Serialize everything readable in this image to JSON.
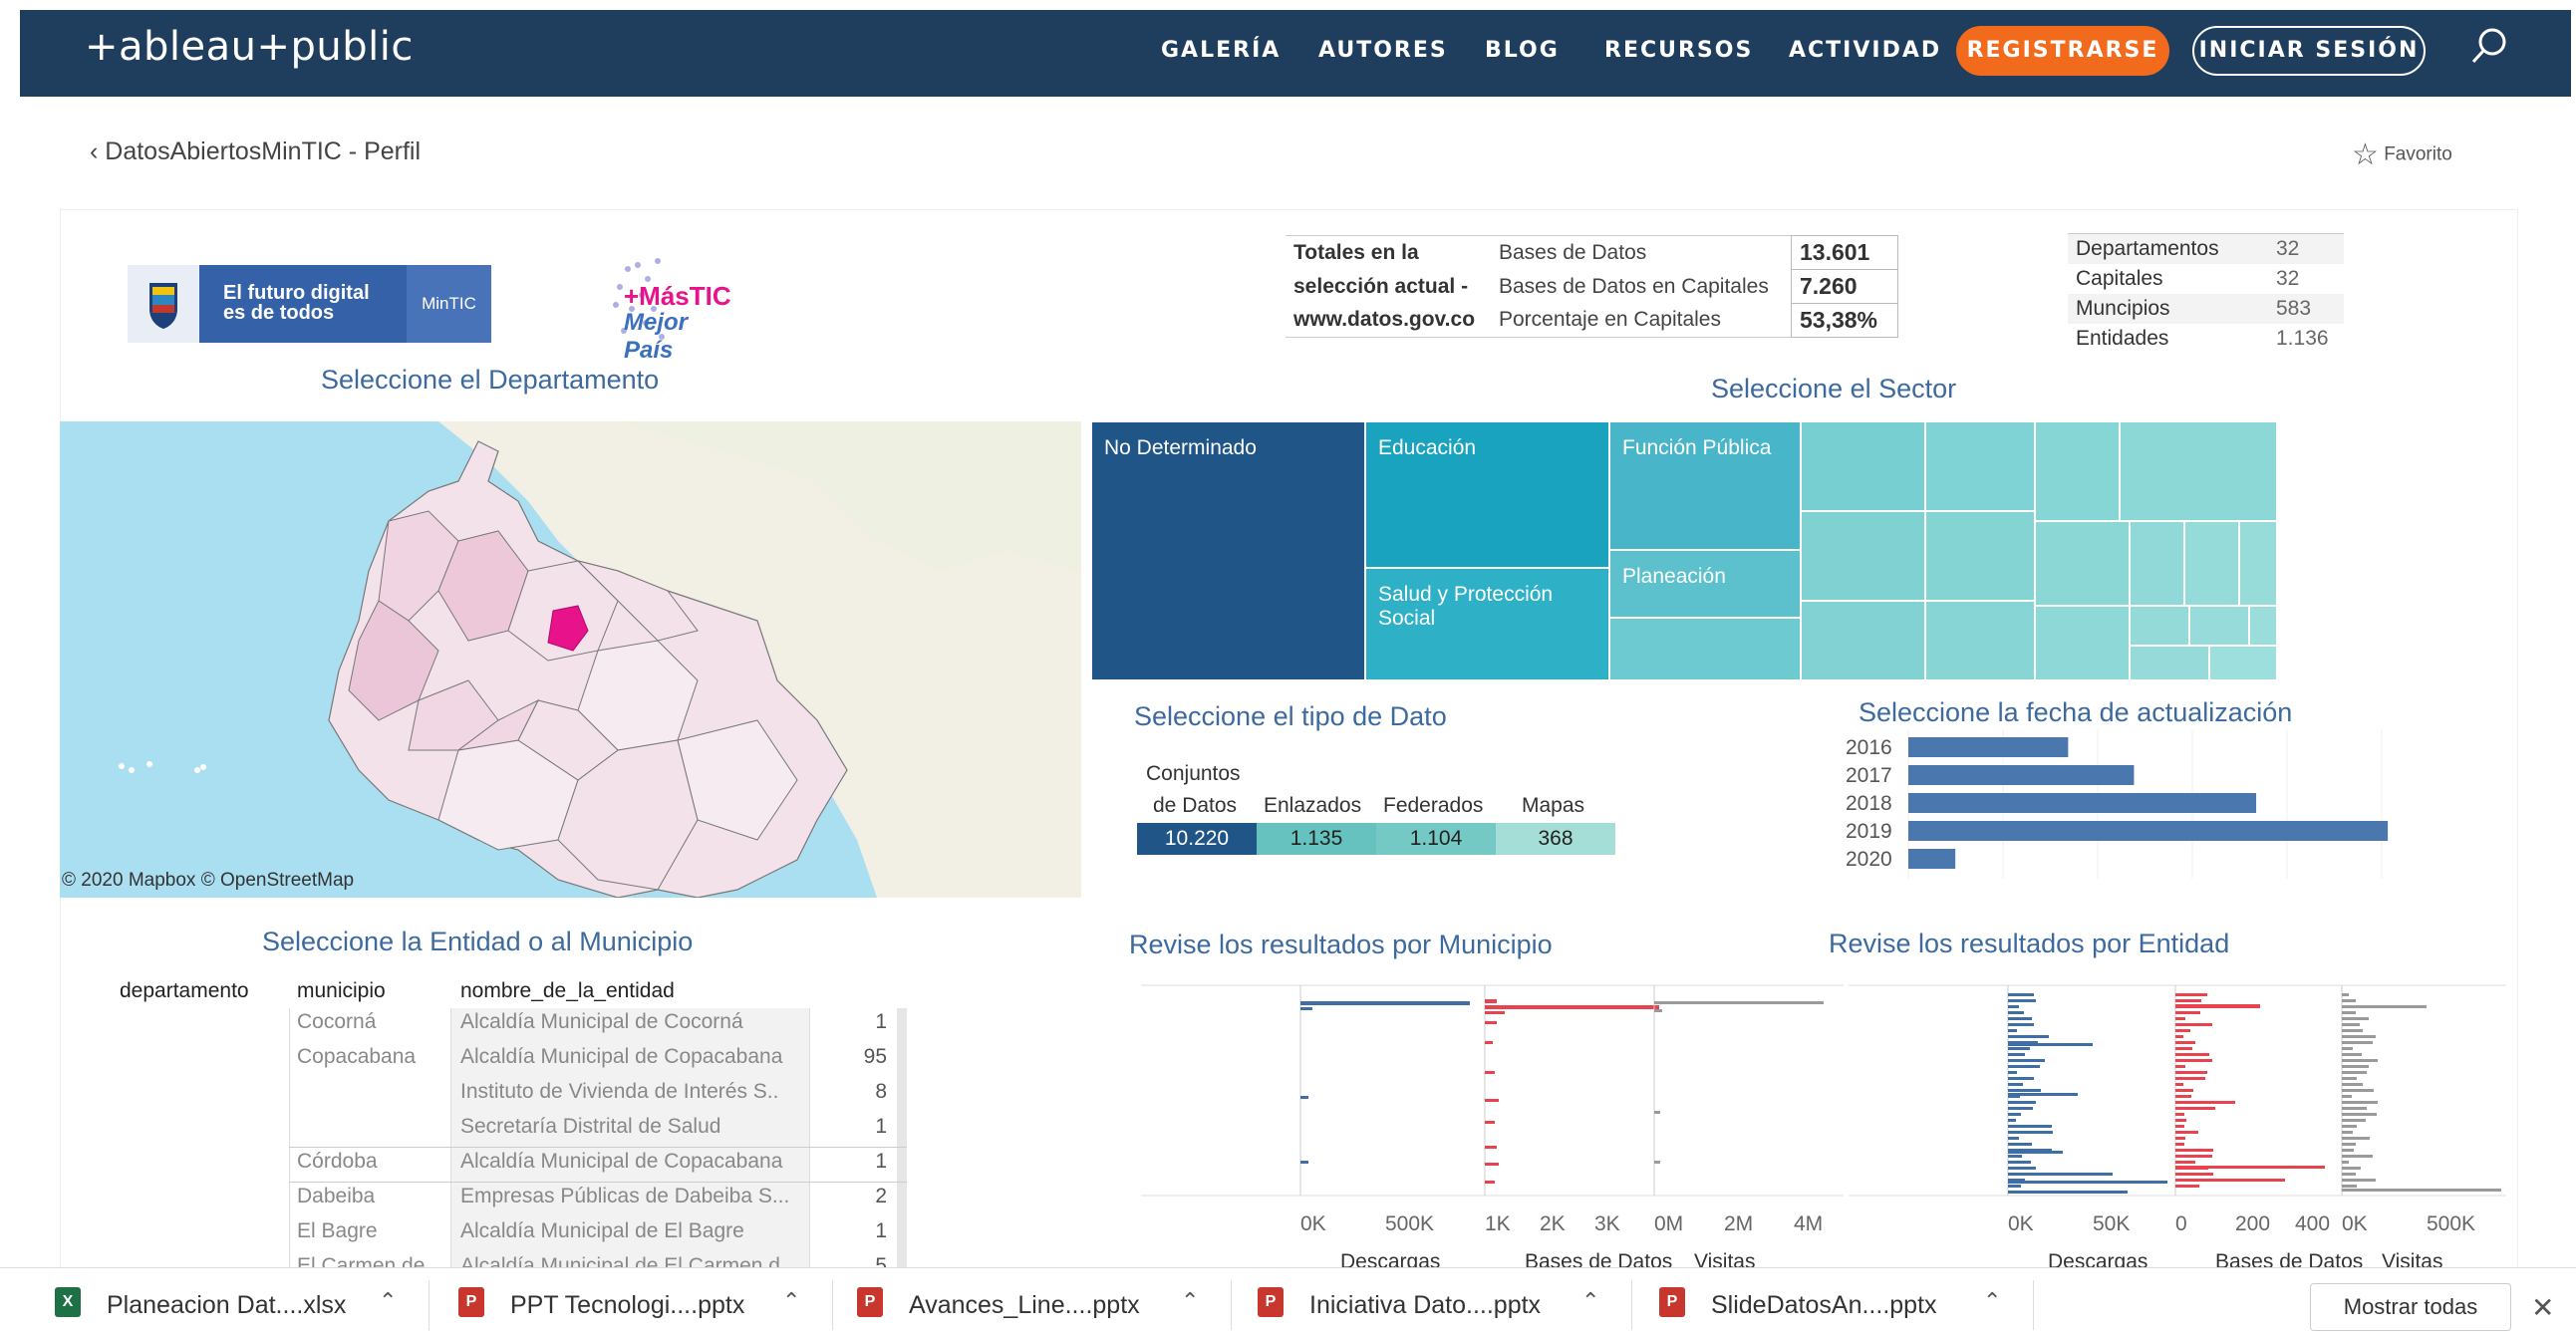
{
  "nav": {
    "logo": "+ableau+public",
    "links": [
      "GALERÍA",
      "AUTORES",
      "BLOG",
      "RECURSOS",
      "ACTIVIDAD"
    ],
    "register": "REGISTRARSE",
    "login": "INICIAR SESIÓN"
  },
  "breadcrumb": "DatosAbiertosMinTIC - Perfil",
  "favorite": "Favorito",
  "banner": {
    "line1": "El futuro digital",
    "line2": "es de todos",
    "mintic": "MinTIC",
    "mastic1": "+MásTIC",
    "mastic2": "Mejor País"
  },
  "totals": {
    "label1": "Totales en la",
    "label2": "selección actual -",
    "label3": "www.datos.gov.co",
    "rows": [
      {
        "name": "Bases de Datos",
        "value": "13.601"
      },
      {
        "name": "Bases de Datos en Capitales",
        "value": "7.260"
      },
      {
        "name": "Porcentaje en Capitales",
        "value": "53,38%"
      }
    ]
  },
  "counts": [
    {
      "name": "Departamentos",
      "value": "32"
    },
    {
      "name": "Capitales",
      "value": "32"
    },
    {
      "name": "Muncipios",
      "value": "583"
    },
    {
      "name": "Entidades",
      "value": "1.136"
    }
  ],
  "titles": {
    "departamento": "Seleccione el Departamento",
    "sector": "Seleccione el Sector",
    "tipo": "Seleccione el tipo de Dato",
    "fecha": "Seleccione la fecha de actualización",
    "entidad": "Seleccione la Entidad o al Municipio",
    "municipio": "Revise los resultados por Municipio",
    "porentidad": "Revise los resultados por Entidad"
  },
  "map": {
    "credit": "© 2020 Mapbox  © OpenStreetMap",
    "colors": {
      "sea": "#aadff2",
      "land": "#f2efe4",
      "dept": "#f3e2ea",
      "highlight": "#e8138a"
    }
  },
  "sector": {
    "items": [
      "No Determinado",
      "Educación",
      "Función Pública",
      "Salud y Protección Social",
      "Planeación"
    ]
  },
  "tipo": {
    "headers": [
      "Conjuntos",
      "de Datos",
      "Enlazados",
      "Federados",
      "Mapas"
    ],
    "values": [
      "10.220",
      "1.135",
      "1.104",
      "368"
    ]
  },
  "chart_data": [
    {
      "type": "bar",
      "title": "Seleccione la fecha de actualización",
      "categories": [
        "2016",
        "2017",
        "2018",
        "2019",
        "2020"
      ],
      "values": [
        1700,
        2400,
        3700,
        5100,
        500
      ],
      "orientation": "horizontal"
    }
  ],
  "entidad_table": {
    "headers": [
      "departamento",
      "municipio",
      "nombre_de_la_entidad"
    ],
    "rows": [
      {
        "municipio": "Cocorná",
        "entidad": "Alcaldía Municipal de Cocorná",
        "n": "1"
      },
      {
        "municipio": "Copacabana",
        "entidad": "Alcaldía Municipal de Copacabana",
        "n": "95"
      },
      {
        "municipio": "",
        "entidad": "Instituto de Vivienda de Interés S..",
        "n": "8"
      },
      {
        "municipio": "",
        "entidad": "Secretaría Distrital de Salud",
        "n": "1"
      },
      {
        "municipio": "Córdoba",
        "entidad": "Alcaldía Municipal de Copacabana",
        "n": "1"
      },
      {
        "municipio": "Dabeiba",
        "entidad": "Empresas Públicas de Dabeiba S...",
        "n": "2"
      },
      {
        "municipio": "El Bagre",
        "entidad": "Alcaldía Municipal de El Bagre",
        "n": "1"
      },
      {
        "municipio": "El Carmen de...",
        "entidad": "Alcaldía Municipal de El Carmen d...",
        "n": "5"
      }
    ]
  },
  "municipio_axes": {
    "descargas": [
      "0K",
      "500K"
    ],
    "bases": [
      "1K",
      "2K",
      "3K"
    ],
    "visitas": [
      "0M",
      "2M",
      "4M"
    ],
    "labels": [
      "Descargas",
      "Bases de Datos",
      "Visitas"
    ]
  },
  "entidad_axes": {
    "descargas": [
      "0K",
      "50K"
    ],
    "bases": [
      "0",
      "200",
      "400"
    ],
    "visitas": [
      "0K",
      "500K"
    ],
    "labels": [
      "Descargas",
      "Bases de Datos",
      "Visitas"
    ]
  },
  "downloads": [
    {
      "name": "Planeacion Dat....xlsx",
      "type": "x"
    },
    {
      "name": "PPT Tecnologi....pptx",
      "type": "p"
    },
    {
      "name": "Avances_Line....pptx",
      "type": "p"
    },
    {
      "name": "Iniciativa Dato....pptx",
      "type": "p"
    },
    {
      "name": "SlideDatosAn....pptx",
      "type": "p"
    }
  ],
  "show_all": "Mostrar todas"
}
